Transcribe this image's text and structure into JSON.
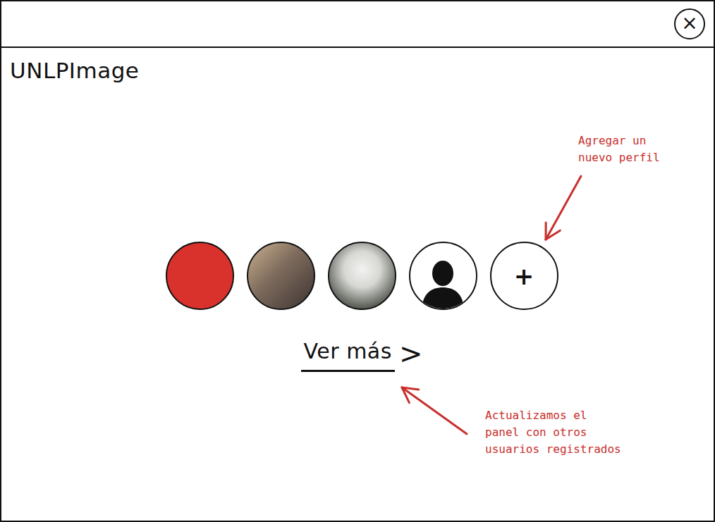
{
  "window": {
    "title": "UNLPImage",
    "close": "×"
  },
  "profiles": [
    {
      "kind": "photo"
    },
    {
      "kind": "photo"
    },
    {
      "kind": "photo"
    },
    {
      "kind": "silhouette"
    }
  ],
  "add_profile": {
    "label": "+"
  },
  "more_link": {
    "label": "Ver más",
    "arrow": ">"
  },
  "annotations": [
    {
      "lines": [
        "Agregar un",
        "nuevo perfil"
      ]
    },
    {
      "lines": [
        "Actualizamos el",
        "panel con otros",
        "usuarios registrados"
      ]
    }
  ]
}
